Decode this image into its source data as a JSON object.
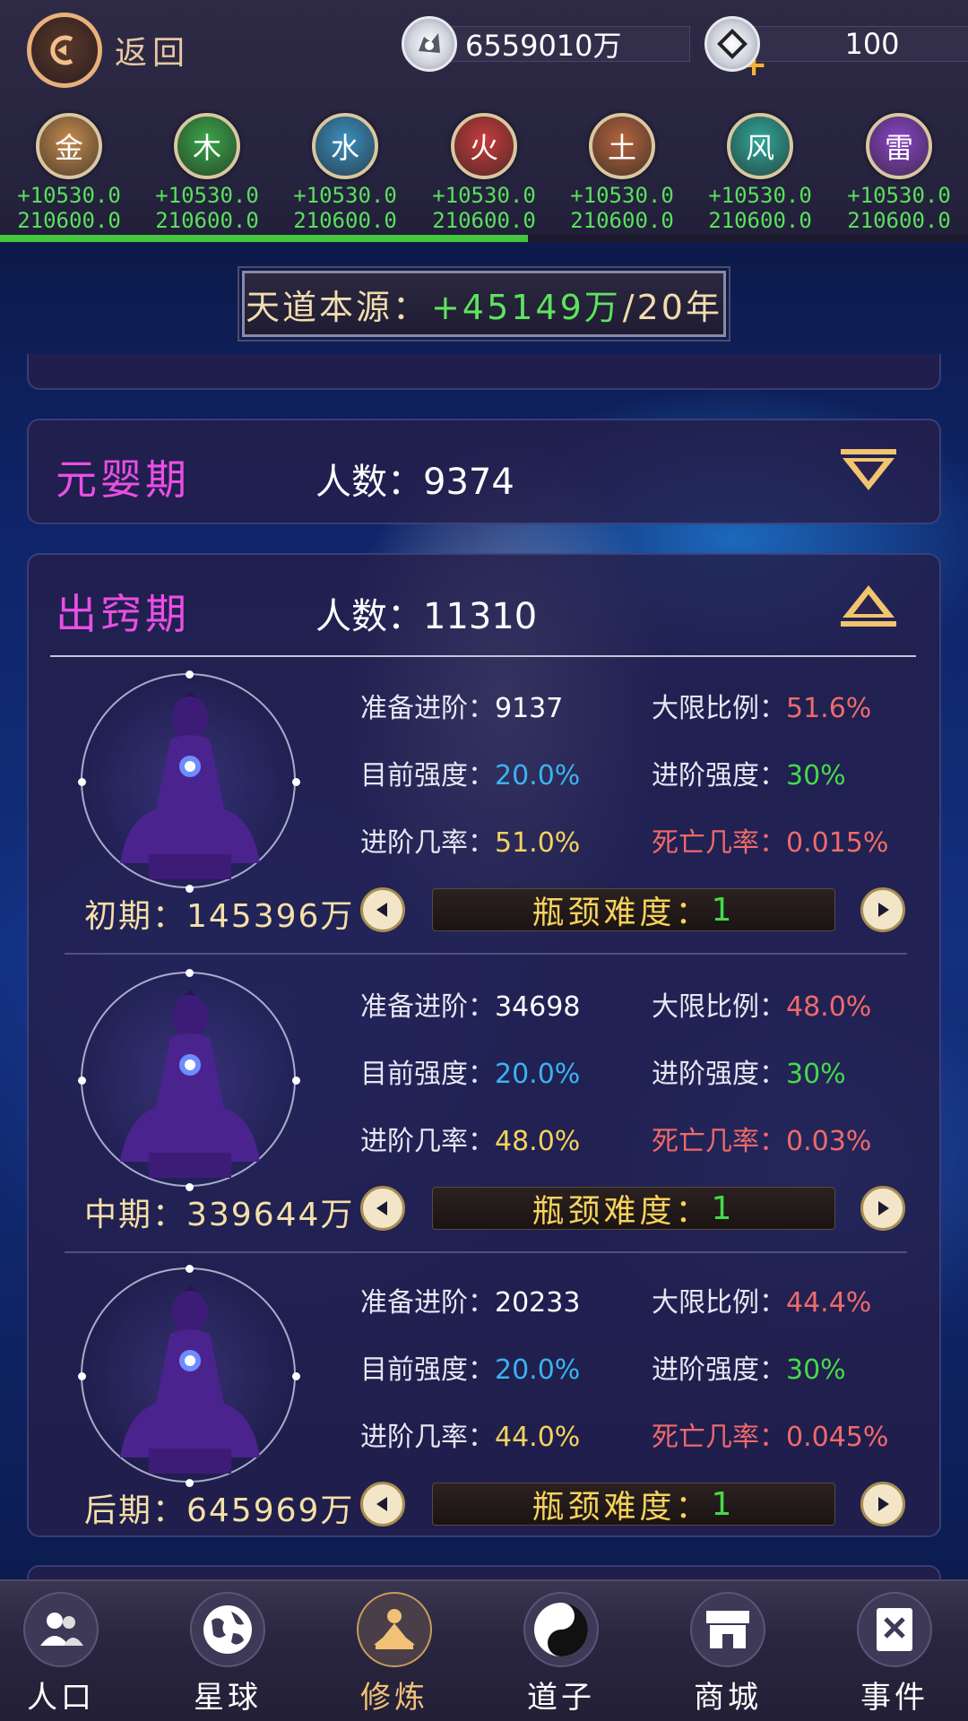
{
  "header": {
    "back_label": "返回",
    "spirit_stones": "6559010万",
    "gems": "100"
  },
  "elements": [
    {
      "name": "金",
      "gain": "+10530.0",
      "total": "210600.0",
      "color": "#c58a4e"
    },
    {
      "name": "木",
      "gain": "+10530.0",
      "total": "210600.0",
      "color": "#3aa647"
    },
    {
      "name": "水",
      "gain": "+10530.0",
      "total": "210600.0",
      "color": "#3b8fc0"
    },
    {
      "name": "火",
      "gain": "+10530.0",
      "total": "210600.0",
      "color": "#c83c3c"
    },
    {
      "name": "土",
      "gain": "+10530.0",
      "total": "210600.0",
      "color": "#b4643e"
    },
    {
      "name": "风",
      "gain": "+10530.0",
      "total": "210600.0",
      "color": "#2fa89a"
    },
    {
      "name": "雷",
      "gain": "+10530.0",
      "total": "210600.0",
      "color": "#8b44c6"
    }
  ],
  "progress": {
    "fraction": 0.545
  },
  "banner": {
    "label": "天道本源：",
    "value": "+45149万",
    "suffix": "/20年"
  },
  "realms": [
    {
      "name": "元婴期",
      "count_label": "人数：",
      "count": "9374",
      "expanded": false
    },
    {
      "name": "出窍期",
      "count_label": "人数：",
      "count": "11310",
      "expanded": true
    }
  ],
  "stages": [
    {
      "label": "初期：145396万",
      "prep_k": "准备进阶：",
      "prep_v": "9137",
      "limit_k": "大限比例：",
      "limit_v": "51.6%",
      "cur_k": "目前强度：",
      "cur_v": "20.0%",
      "adv_k": "进阶强度：",
      "adv_v": "30%",
      "rate_k": "进阶几率：",
      "rate_v": "51.0%",
      "death_k": "死亡几率：",
      "death_v": "0.015%",
      "diff_k": "瓶颈难度：",
      "diff_v": "1"
    },
    {
      "label": "中期：339644万",
      "prep_k": "准备进阶：",
      "prep_v": "34698",
      "limit_k": "大限比例：",
      "limit_v": "48.0%",
      "cur_k": "目前强度：",
      "cur_v": "20.0%",
      "adv_k": "进阶强度：",
      "adv_v": "30%",
      "rate_k": "进阶几率：",
      "rate_v": "48.0%",
      "death_k": "死亡几率：",
      "death_v": "0.03%",
      "diff_k": "瓶颈难度：",
      "diff_v": "1"
    },
    {
      "label": "后期：645969万",
      "prep_k": "准备进阶：",
      "prep_v": "20233",
      "limit_k": "大限比例：",
      "limit_v": "44.4%",
      "cur_k": "目前强度：",
      "cur_v": "20.0%",
      "adv_k": "进阶强度：",
      "adv_v": "30%",
      "rate_k": "进阶几率：",
      "rate_v": "44.0%",
      "death_k": "死亡几率：",
      "death_v": "0.045%",
      "diff_k": "瓶颈难度：",
      "diff_v": "1"
    }
  ],
  "nav": [
    {
      "label": "人口",
      "icon": "people-icon"
    },
    {
      "label": "星球",
      "icon": "globe-icon"
    },
    {
      "label": "修炼",
      "icon": "meditate-icon",
      "active": true
    },
    {
      "label": "道子",
      "icon": "yin-yang-icon"
    },
    {
      "label": "商城",
      "icon": "shop-icon"
    },
    {
      "label": "事件",
      "icon": "book-icon"
    }
  ]
}
